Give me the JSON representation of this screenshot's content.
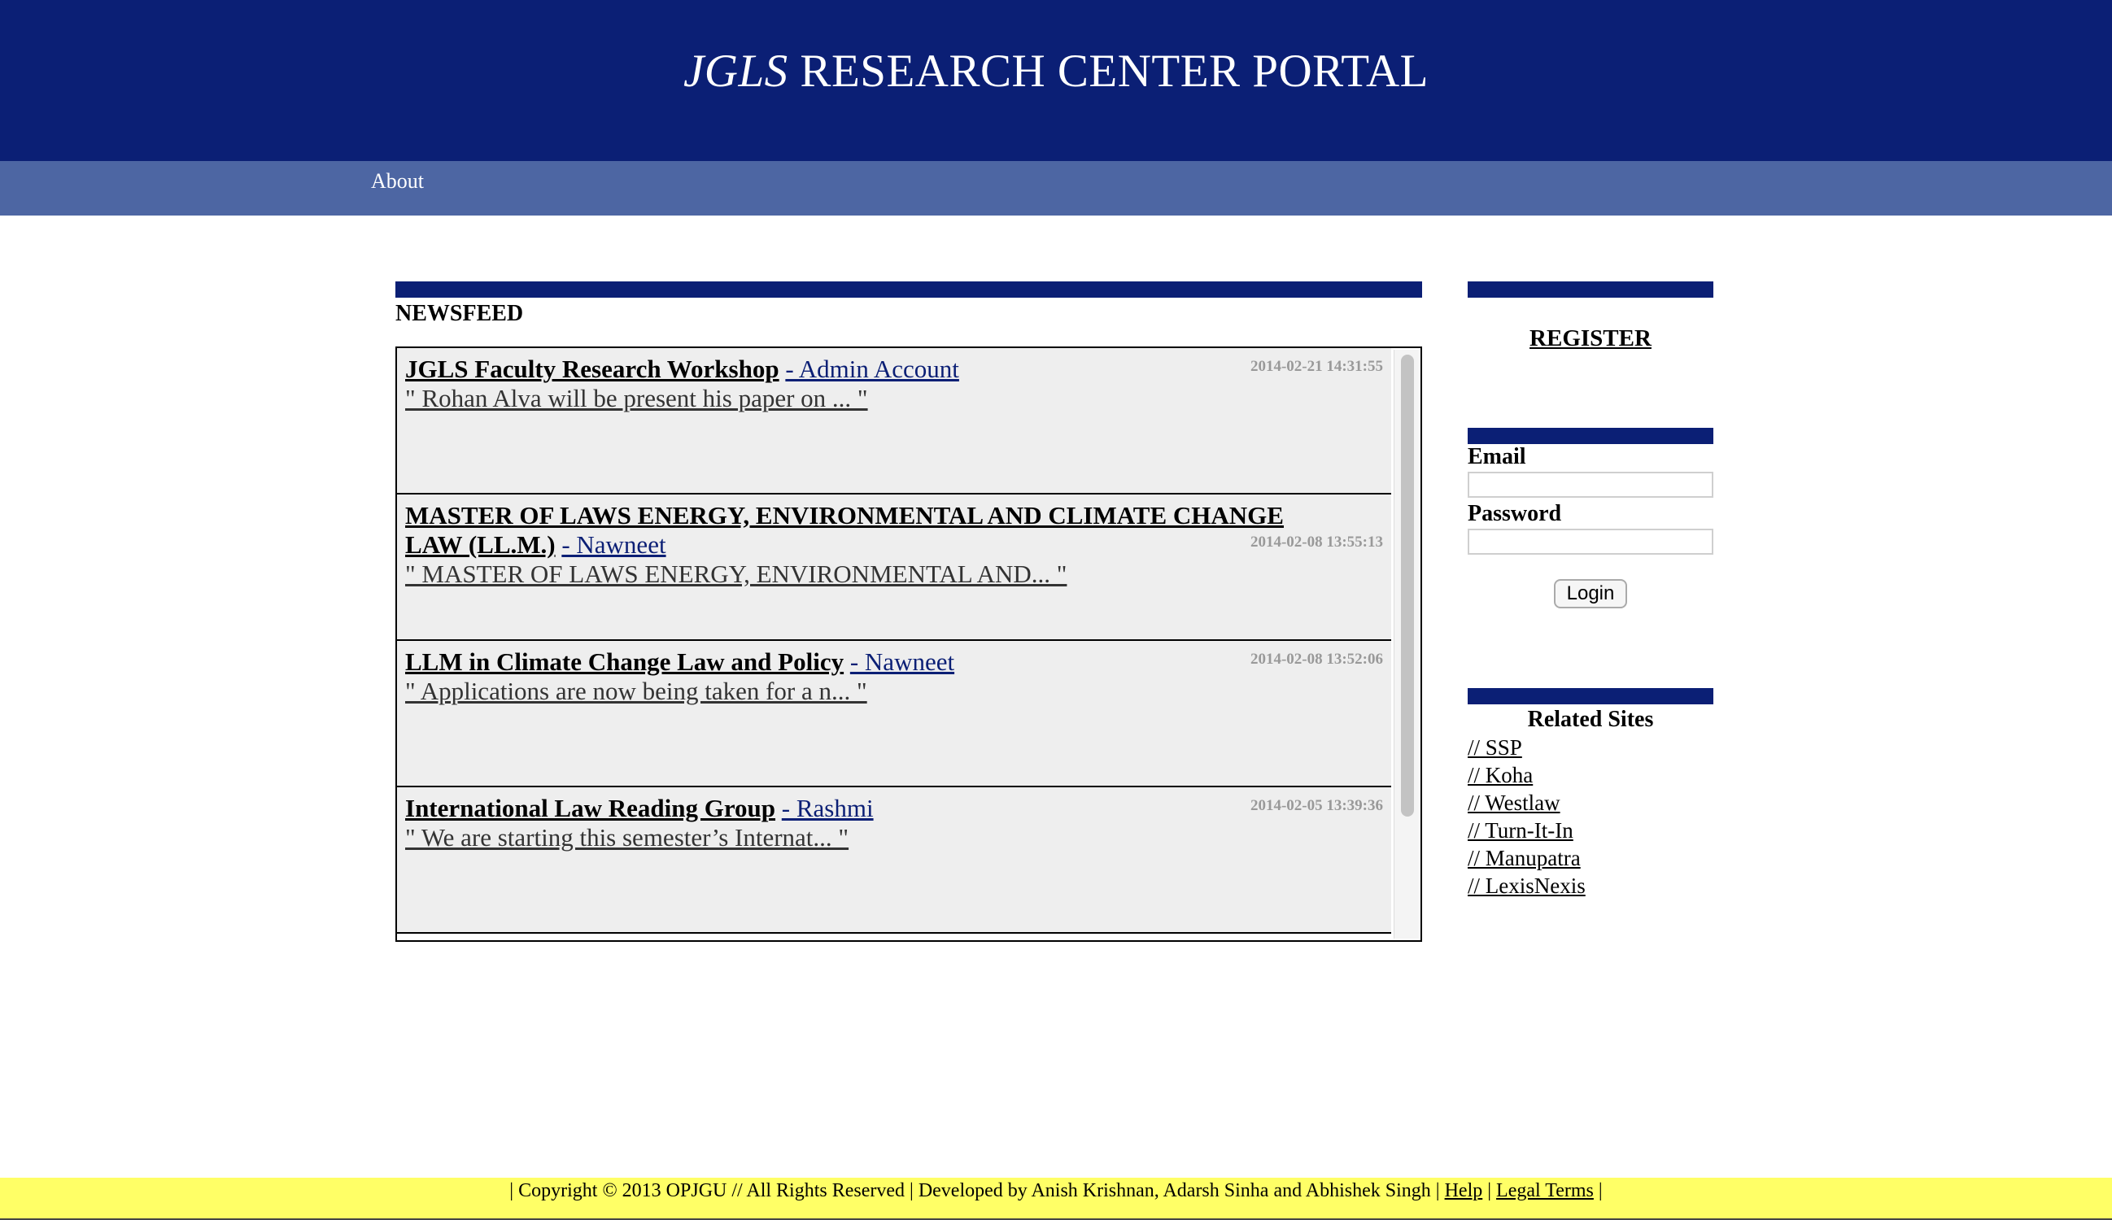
{
  "header": {
    "brand": "JGLS",
    "title_rest": "RESEARCH CENTER PORTAL"
  },
  "nav": {
    "items": [
      {
        "label": "About"
      }
    ]
  },
  "newsfeed": {
    "title": "NEWSFEED",
    "items": [
      {
        "title": "JGLS Faculty Research Workshop",
        "author": "- Admin Account",
        "date": "2014-02-21 14:31:55",
        "excerpt": "\" Rohan Alva will be present his paper on ... \""
      },
      {
        "title": "MASTER OF LAWS ENERGY, ENVIRONMENTAL AND CLIMATE CHANGE LAW (LL.M.)",
        "author": "- Nawneet",
        "date": "2014-02-08 13:55:13",
        "excerpt": "\" MASTER OF LAWS ENERGY, ENVIRONMENTAL AND... \""
      },
      {
        "title": "LLM in Climate Change Law and Policy",
        "author": "- Nawneet",
        "date": "2014-02-08 13:52:06",
        "excerpt": "\" Applications are now being taken for a n... \""
      },
      {
        "title": "International Law Reading Group",
        "author": "- Rashmi",
        "date": "2014-02-05 13:39:36",
        "excerpt": "\" We are starting this semester’s Internat... \""
      }
    ]
  },
  "sidebar": {
    "register_label": "REGISTER",
    "email_label": "Email",
    "password_label": "Password",
    "login_label": "Login",
    "related_heading": "Related Sites",
    "related_links": [
      {
        "label": "// SSP"
      },
      {
        "label": "// Koha"
      },
      {
        "label": "// Westlaw"
      },
      {
        "label": "// Turn-It-In"
      },
      {
        "label": "// Manupatra"
      },
      {
        "label": "// LexisNexis"
      }
    ]
  },
  "footer": {
    "prefix": "| Copyright © 2013 OPJGU // All Rights Reserved | Developed by Anish Krishnan, Adarsh Sinha and Abhishek Singh |",
    "help_label": "Help",
    "separator": "|",
    "legal_label": "Legal Terms",
    "suffix": "|"
  },
  "colors": {
    "header_bg": "#0b1f75",
    "nav_bg": "#4d66a3",
    "footer_bg": "#ffff66",
    "feed_item_bg": "#eeeeee"
  }
}
